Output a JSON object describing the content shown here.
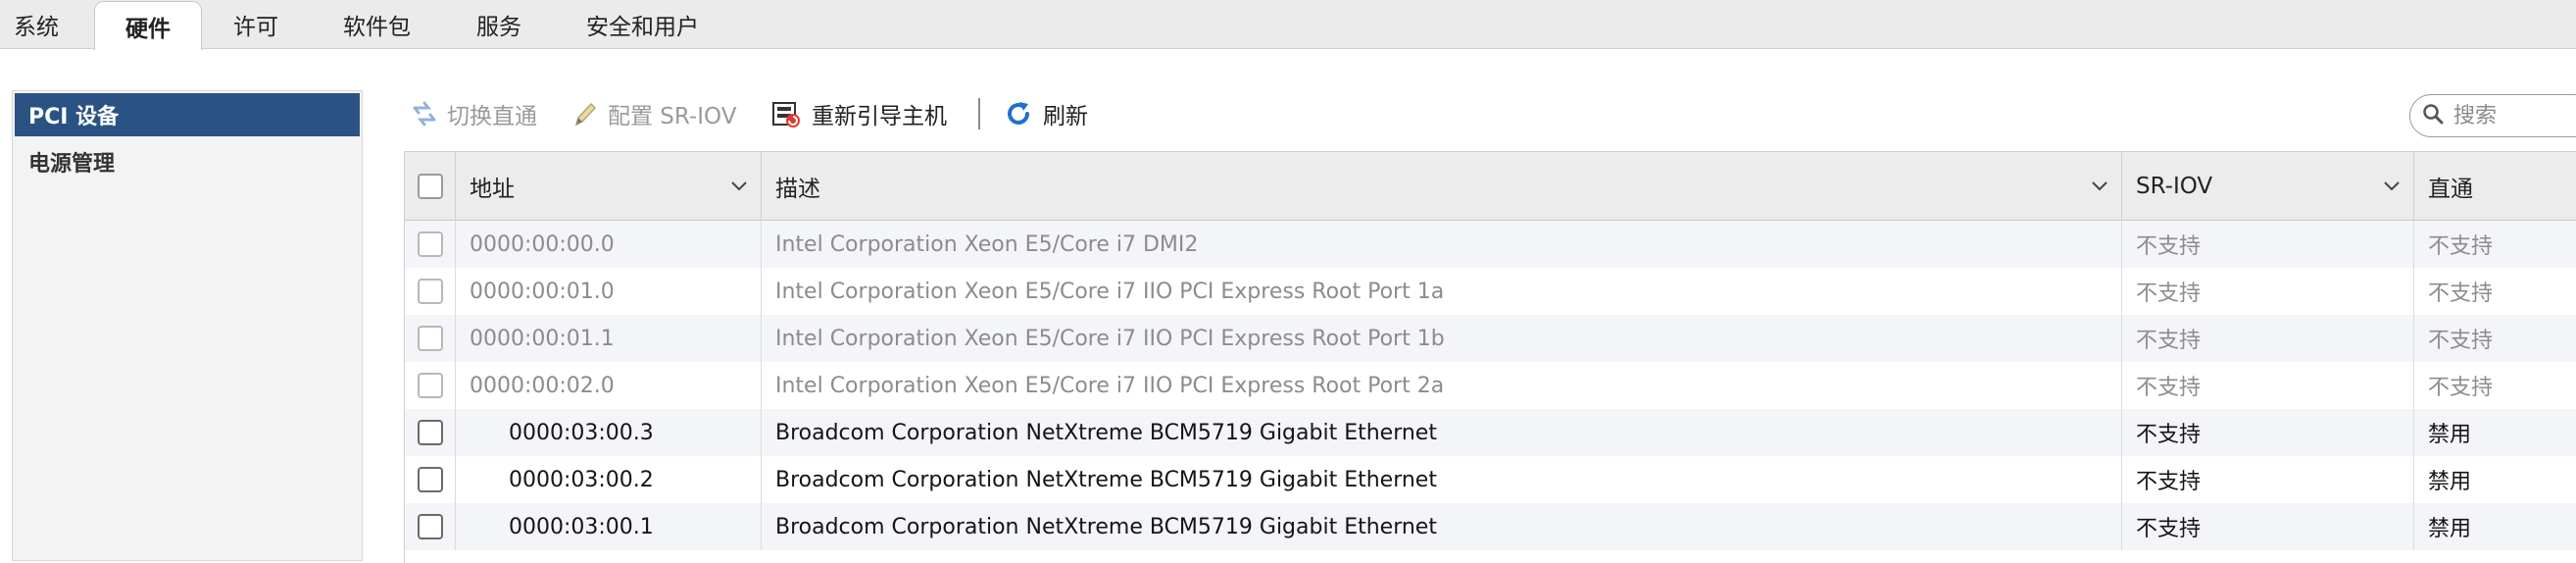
{
  "tabs": [
    {
      "label": "系统",
      "active": false
    },
    {
      "label": "硬件",
      "active": true
    },
    {
      "label": "许可",
      "active": false
    },
    {
      "label": "软件包",
      "active": false
    },
    {
      "label": "服务",
      "active": false
    },
    {
      "label": "安全和用户",
      "active": false
    }
  ],
  "sidebar": {
    "items": [
      {
        "label": "PCI 设备",
        "selected": true
      },
      {
        "label": "电源管理",
        "selected": false
      }
    ]
  },
  "toolbar": {
    "toggle_passthrough": "切换直通",
    "configure_sriov": "配置 SR-IOV",
    "reboot_host": "重新引导主机",
    "refresh": "刷新"
  },
  "search": {
    "placeholder": "搜索"
  },
  "table": {
    "columns": [
      "地址",
      "描述",
      "SR-IOV",
      "直通"
    ],
    "rows": [
      {
        "address": "0000:00:00.0",
        "description": "Intel Corporation Xeon E5/Core i7 DMI2",
        "sriov": "不支持",
        "passthrough": "不支持",
        "enabled": false
      },
      {
        "address": "0000:00:01.0",
        "description": "Intel Corporation Xeon E5/Core i7 IIO PCI Express Root Port 1a",
        "sriov": "不支持",
        "passthrough": "不支持",
        "enabled": false
      },
      {
        "address": "0000:00:01.1",
        "description": "Intel Corporation Xeon E5/Core i7 IIO PCI Express Root Port 1b",
        "sriov": "不支持",
        "passthrough": "不支持",
        "enabled": false
      },
      {
        "address": "0000:00:02.0",
        "description": "Intel Corporation Xeon E5/Core i7 IIO PCI Express Root Port 2a",
        "sriov": "不支持",
        "passthrough": "不支持",
        "enabled": false
      },
      {
        "address": "0000:03:00.3",
        "description": "Broadcom Corporation NetXtreme BCM5719 Gigabit Ethernet",
        "sriov": "不支持",
        "passthrough": "禁用",
        "enabled": true
      },
      {
        "address": "0000:03:00.2",
        "description": "Broadcom Corporation NetXtreme BCM5719 Gigabit Ethernet",
        "sriov": "不支持",
        "passthrough": "禁用",
        "enabled": true
      },
      {
        "address": "0000:03:00.1",
        "description": "Broadcom Corporation NetXtreme BCM5719 Gigabit Ethernet",
        "sriov": "不支持",
        "passthrough": "禁用",
        "enabled": true
      }
    ]
  },
  "colors": {
    "selected_nav": "#2a5384",
    "refresh_icon": "#1f6fd0",
    "header_bg": "#ececec"
  }
}
